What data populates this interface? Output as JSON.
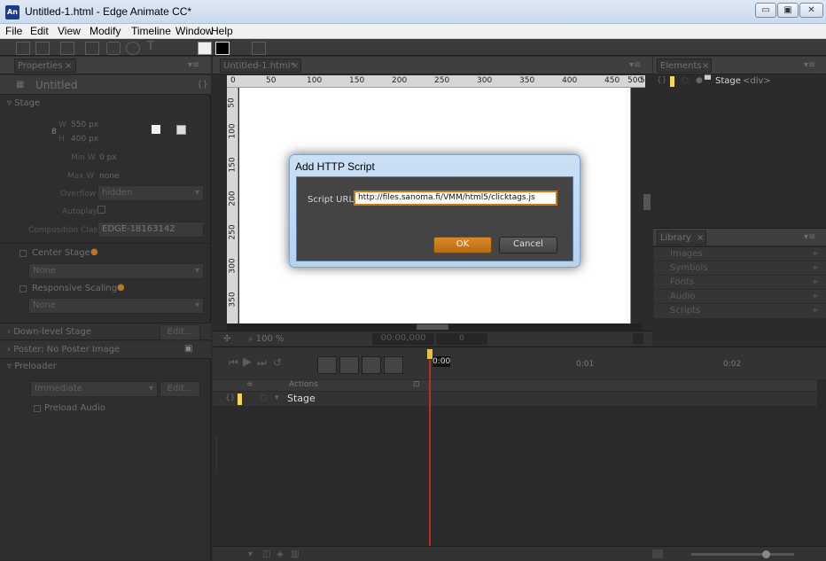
{
  "window": {
    "title": "Untitled-1.html - Edge Animate CC*",
    "app_icon_text": "An",
    "minimize": "▭",
    "maximize": "▣",
    "close": "✕"
  },
  "menu": [
    "File",
    "Edit",
    "View",
    "Modify",
    "Timeline",
    "Window",
    "Help"
  ],
  "properties": {
    "tab": "Properties",
    "name": "Untitled",
    "stage_label": "Stage",
    "w_label": "W",
    "w_value": "550",
    "w_unit": "px",
    "h_label": "H",
    "h_value": "400",
    "h_unit": "px",
    "min_w_label": "Min W",
    "min_w_value": "0",
    "min_w_unit": "px",
    "max_w_label": "Max W",
    "max_w_value": "none",
    "overflow_label": "Overflow",
    "overflow_value": "hidden",
    "autoplay_label": "Autoplay",
    "composition_label": "Composition Class",
    "composition_value": "EDGE-18163142",
    "center_stage": "Center Stage",
    "center_none": "None",
    "responsive": "Responsive Scaling",
    "responsive_none": "None",
    "downlevel": "Down-level Stage",
    "downlevel_edit": "Edit...",
    "poster": "Poster: No Poster Image",
    "preloader": "Preloader",
    "immediate": "Immediate",
    "preloader_edit": "Edit...",
    "preload_audio": "Preload Audio"
  },
  "stage": {
    "tab": "Untitled-1.html*",
    "ruler_h": [
      "0",
      "50",
      "100",
      "150",
      "200",
      "250",
      "300",
      "350",
      "400",
      "450",
      "500",
      "550"
    ],
    "ruler_v": [
      "50",
      "100",
      "150",
      "200",
      "250",
      "300",
      "350"
    ],
    "zoom": "100 %",
    "time": "00:00,000",
    "time_extra": "0"
  },
  "elements": {
    "tab": "Elements",
    "stage_item": "Stage",
    "stage_tag": "<div>"
  },
  "library": {
    "tab": "Library",
    "rows": [
      "Images",
      "Symbols",
      "Fonts",
      "Audio",
      "Scripts"
    ],
    "plus": "+"
  },
  "timeline": {
    "current": "0:00",
    "marks": [
      "0:01",
      "0:02"
    ],
    "actions": "Actions",
    "stage_row": "Stage"
  },
  "dialog": {
    "title": "Add HTTP Script",
    "url_label": "Script URL:",
    "url_value": "http://files.sanoma.fi/VMM/html5/clicktags.js",
    "ok": "OK",
    "cancel": "Cancel"
  },
  "colors": {
    "accent_orange": "#c8781a",
    "playhead_red": "#c0282d",
    "stage_bg": "#ffffff",
    "panel_bg": "#2b2b2b"
  }
}
